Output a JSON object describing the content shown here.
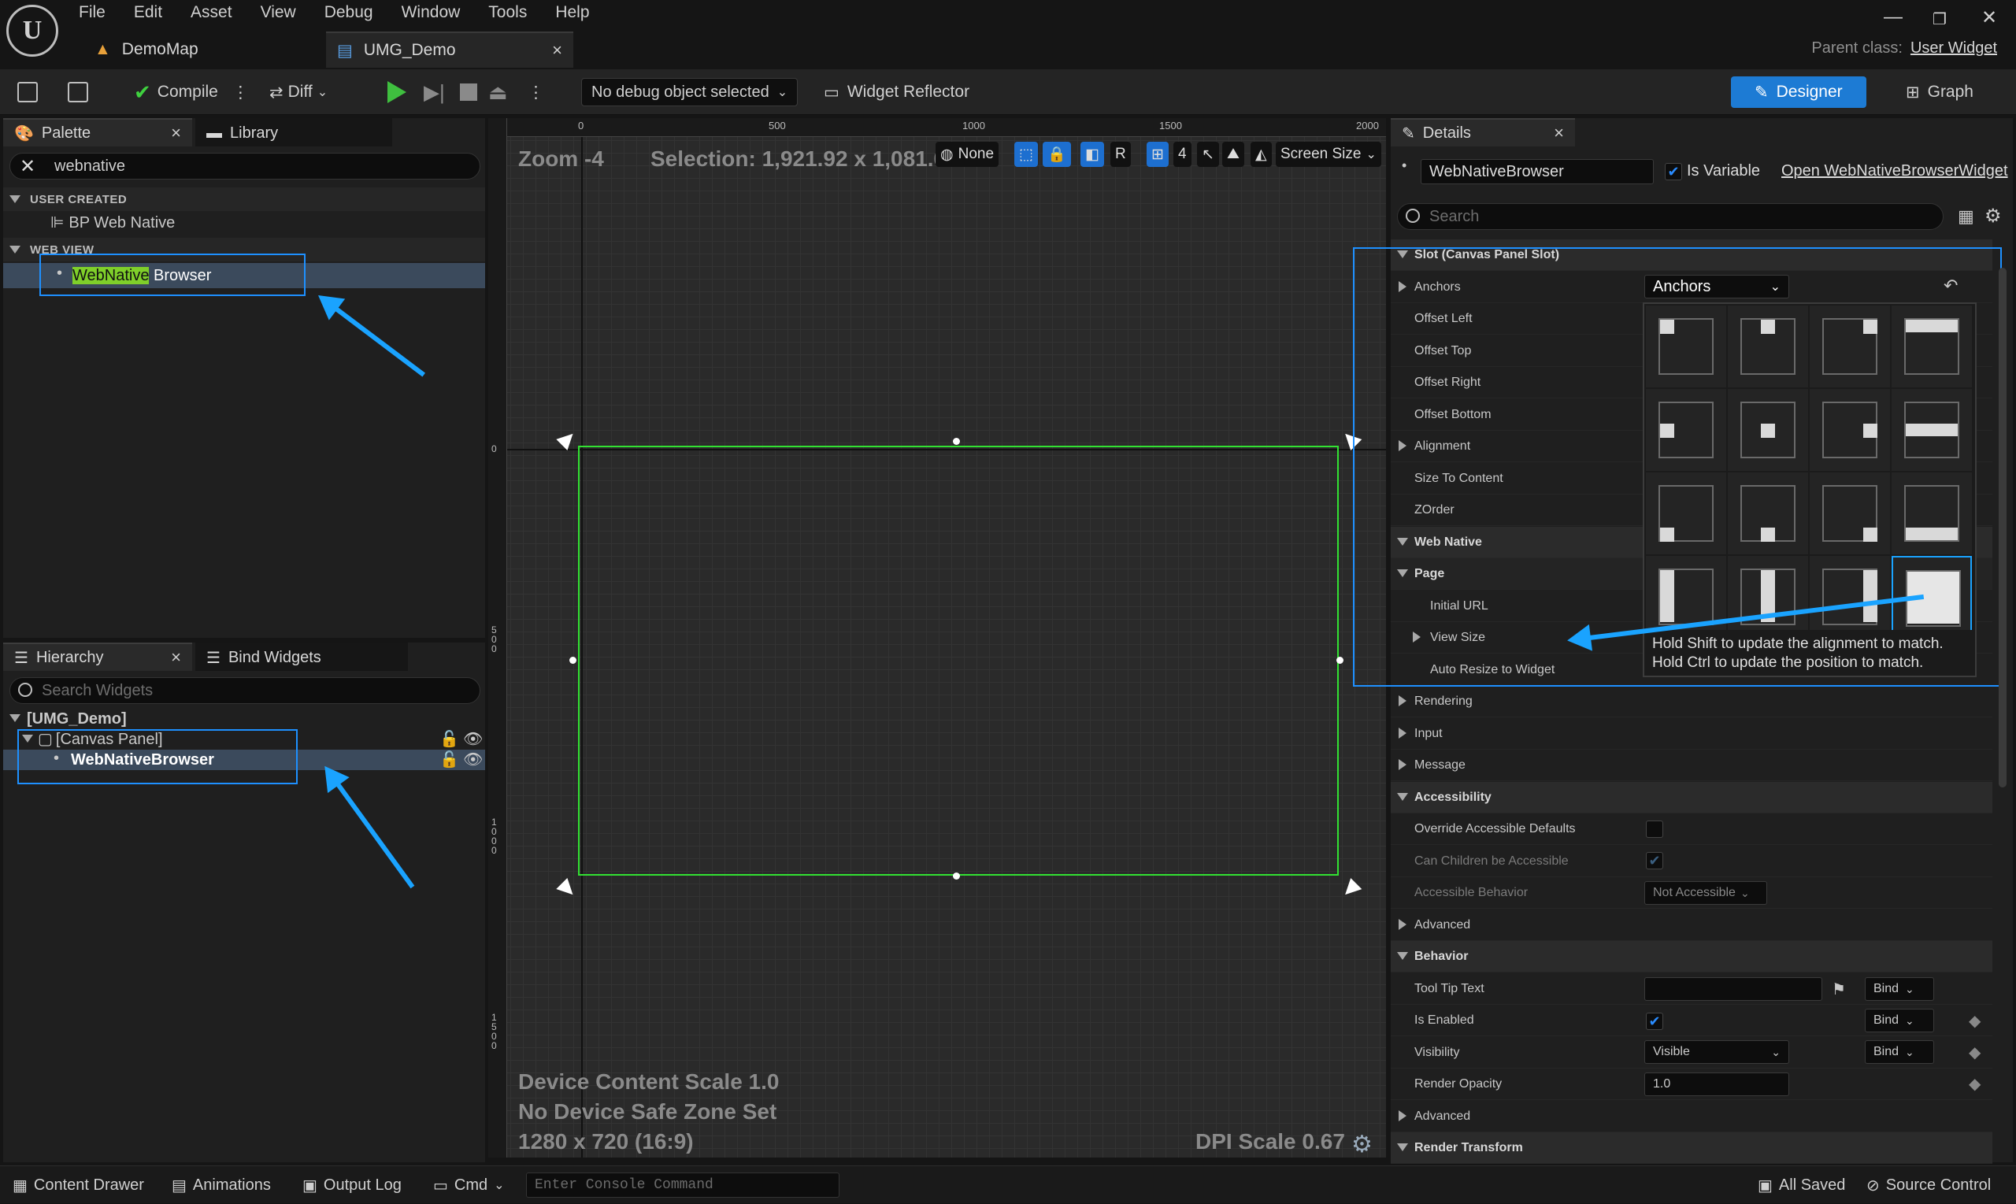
{
  "menu": [
    "File",
    "Edit",
    "Asset",
    "View",
    "Debug",
    "Window",
    "Tools",
    "Help"
  ],
  "tabs": {
    "demomap": "DemoMap",
    "umg": "UMG_Demo"
  },
  "parent_class": {
    "label": "Parent class:",
    "value": "User Widget"
  },
  "toolbar": {
    "compile": "Compile",
    "diff": "Diff",
    "debug_object": "No debug object selected",
    "widget_reflector": "Widget Reflector",
    "designer": "Designer",
    "graph": "Graph"
  },
  "palette": {
    "tab": "Palette",
    "library_tab": "Library",
    "search_value": "webnative",
    "sections": [
      "USER CREATED",
      "WEB VIEW"
    ],
    "items": {
      "bp_web_native": "BP Web Native",
      "highlight": "WebNative",
      "rest": " Browser"
    }
  },
  "hierarchy": {
    "tab": "Hierarchy",
    "bind_tab": "Bind Widgets",
    "search_placeholder": "Search Widgets",
    "root": "[UMG_Demo]",
    "canvas": "[Canvas Panel]",
    "child": "WebNativeBrowser"
  },
  "viewport": {
    "zoom": "Zoom -4",
    "selection": "Selection: 1,921.92 x 1,081.08",
    "none": "None",
    "r": "R",
    "grid_num": "4",
    "screen_size": "Screen Size",
    "ruler_top": [
      "0",
      "500",
      "1000",
      "1500",
      "2000"
    ],
    "ruler_left": [
      "0",
      "500",
      "1000",
      "1500"
    ],
    "device_scale": "Device Content Scale 1.0",
    "safe_zone": "No Device Safe Zone Set",
    "resolution": "1280 x 720 (16:9)",
    "dpi": "DPI Scale 0.67"
  },
  "details": {
    "tab": "Details",
    "widget_name": "WebNativeBrowser",
    "is_variable": "Is Variable",
    "open_link": "Open WebNativeBrowserWidget",
    "search_placeholder": "Search",
    "rows": [
      {
        "label": "Slot (Canvas Panel Slot)",
        "cat": true
      },
      {
        "label": "Anchors",
        "expand": true
      },
      {
        "label": "Offset Left"
      },
      {
        "label": "Offset Top"
      },
      {
        "label": "Offset Right"
      },
      {
        "label": "Offset Bottom"
      },
      {
        "label": "Alignment",
        "expand": true
      },
      {
        "label": "Size To Content"
      },
      {
        "label": "ZOrder"
      },
      {
        "label": "Web Native",
        "cat": true
      },
      {
        "label": "Page",
        "cat2": true
      },
      {
        "label": "Initial URL",
        "indent": true
      },
      {
        "label": "View Size",
        "indent": true,
        "expand": true
      },
      {
        "label": "Auto Resize to Widget",
        "indent": true
      },
      {
        "label": "Rendering",
        "expand": true
      },
      {
        "label": "Input",
        "expand": true
      },
      {
        "label": "Message",
        "expand": true
      },
      {
        "label": "Accessibility",
        "cat": true
      },
      {
        "label": "Override Accessible Defaults"
      },
      {
        "label": "Can Children be Accessible",
        "dim": true
      },
      {
        "label": "Accessible Behavior",
        "dim": true
      },
      {
        "label": "Advanced",
        "expand": true
      },
      {
        "label": "Behavior",
        "cat": true
      },
      {
        "label": "Tool Tip Text"
      },
      {
        "label": "Is Enabled"
      },
      {
        "label": "Visibility"
      },
      {
        "label": "Render Opacity"
      },
      {
        "label": "Advanced",
        "expand": true
      },
      {
        "label": "Render Transform",
        "cat": true
      }
    ],
    "anchors_dropdown": "Anchors",
    "not_accessible": "Not Accessible",
    "bind": "Bind",
    "visibility_value": "Visible",
    "opacity_value": "1.0",
    "tooltip_line1": "Hold Shift to update the alignment to match.",
    "tooltip_line2": "Hold Ctrl to update the position to match."
  },
  "status": {
    "content_drawer": "Content Drawer",
    "animations": "Animations",
    "output_log": "Output Log",
    "cmd": "Cmd",
    "console_placeholder": "Enter Console Command",
    "all_saved": "All Saved",
    "source_control": "Source Control"
  },
  "colors": {
    "accent": "#1d7bd4",
    "highlight": "#7fcf2a",
    "selection_green": "#32e132",
    "annotation_blue": "#1aa3ff"
  }
}
